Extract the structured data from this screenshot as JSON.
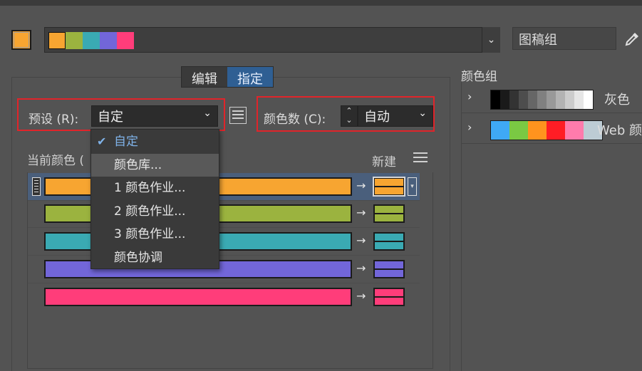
{
  "topbar": {
    "current_color": "#f7a531"
  },
  "color_strip": [
    "#f7a531",
    "#9bb33f",
    "#3aaab3",
    "#7266d9",
    "#ff3d7a"
  ],
  "group_name": {
    "value": "图稿组"
  },
  "tabs": [
    {
      "label": "编辑",
      "active": false
    },
    {
      "label": "指定",
      "active": true
    }
  ],
  "preset": {
    "label": "预设 (R):",
    "value": "自定"
  },
  "color_count": {
    "label": "颜色数 (C):",
    "value": "自动"
  },
  "table": {
    "current_colors_label": "当前颜色 (",
    "new_label": "新建",
    "rows": [
      {
        "color": "#f7a531",
        "selected": true
      },
      {
        "color": "#9bb33f",
        "selected": false
      },
      {
        "color": "#3aaab3",
        "selected": false
      },
      {
        "color": "#7266d9",
        "selected": false
      },
      {
        "color": "#ff3d7a",
        "selected": false
      }
    ],
    "arrow": "→"
  },
  "preset_menu": {
    "items": [
      {
        "label": "自定",
        "checked": true
      },
      {
        "label": "颜色库...",
        "hover": true
      },
      {
        "label": "1 颜色作业..."
      },
      {
        "label": "2 颜色作业..."
      },
      {
        "label": "3 颜色作业..."
      },
      {
        "label": "颜色协调"
      }
    ]
  },
  "color_groups": {
    "title": "颜色组",
    "groups": [
      {
        "label": "灰色",
        "swatches": [
          "#000000",
          "#1a1a1a",
          "#333333",
          "#4d4d4d",
          "#666666",
          "#808080",
          "#999999",
          "#b3b3b3",
          "#cccccc",
          "#e6e6e6",
          "#ffffff"
        ]
      },
      {
        "label": "Web 颜色",
        "swatches": [
          "#3fa9f5",
          "#3fa9f5",
          "#7ac943",
          "#7ac943",
          "#ff931e",
          "#ff931e",
          "#ff1d25",
          "#ff1d25",
          "#ff7bac",
          "#ff7bac",
          "#bdccd4",
          "#bdccd4"
        ]
      }
    ]
  }
}
